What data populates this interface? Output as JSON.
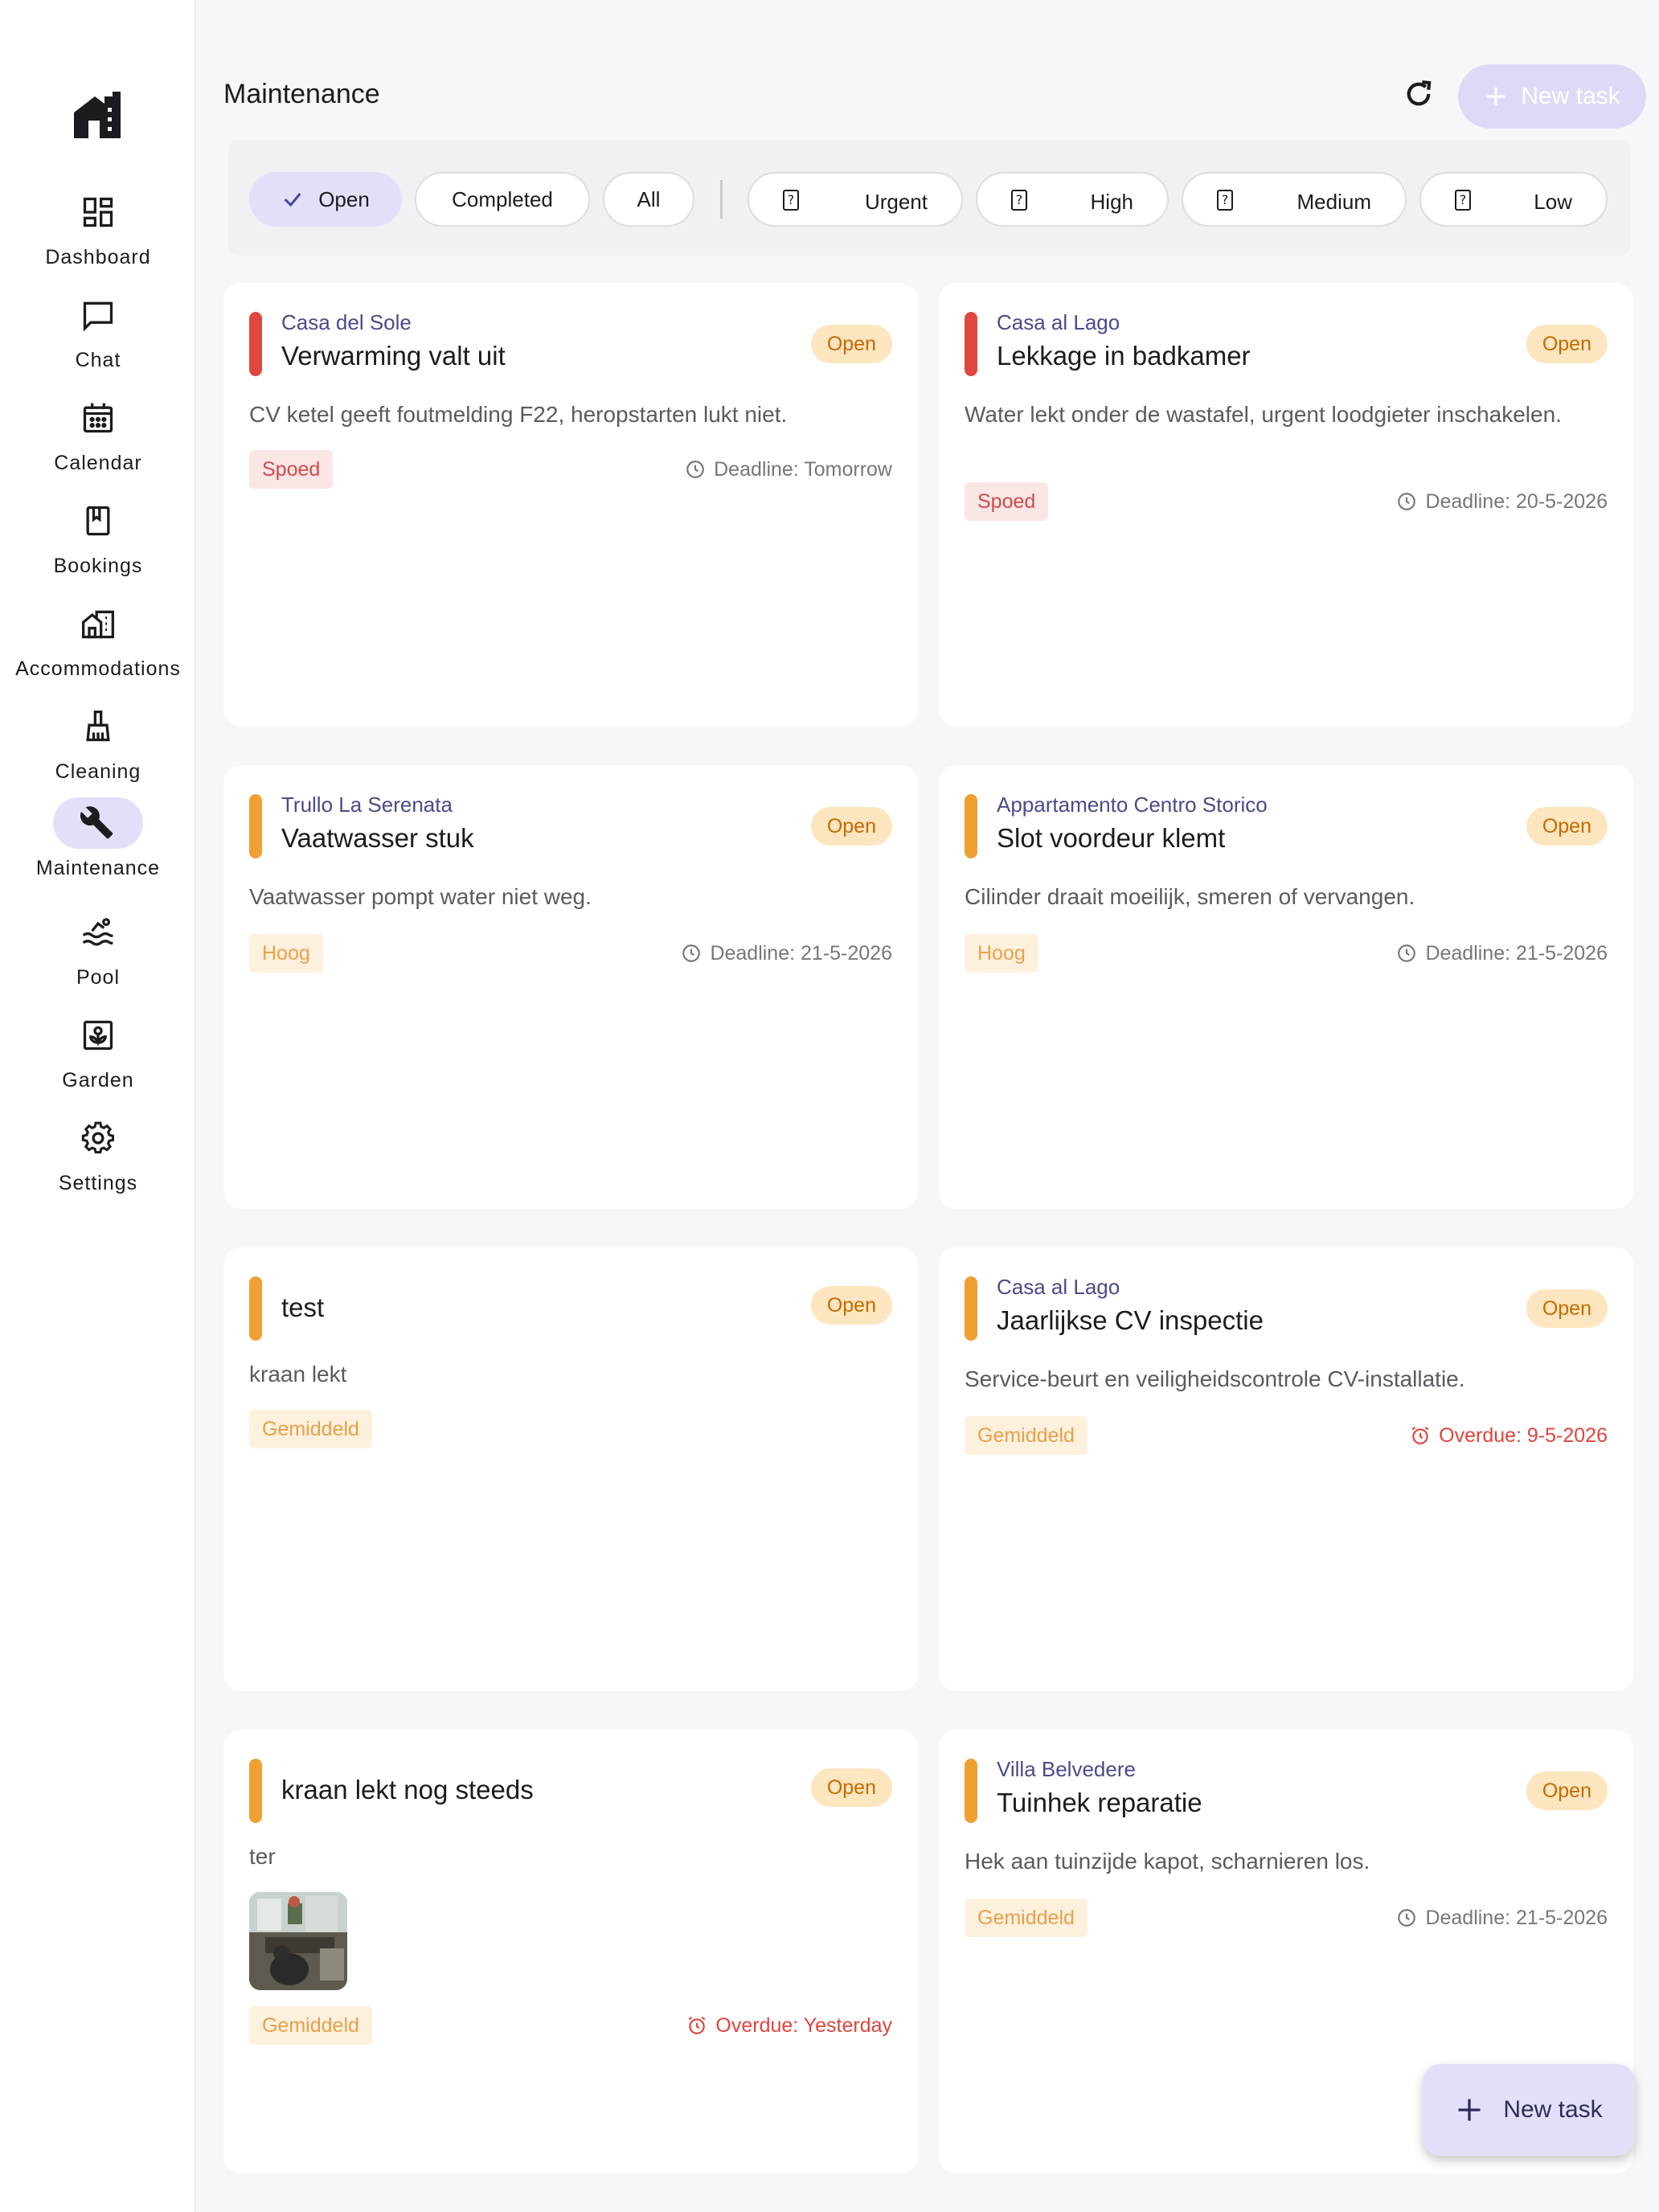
{
  "nav": {
    "items": [
      {
        "label": "Dashboard",
        "icon": "dashboard-icon"
      },
      {
        "label": "Chat",
        "icon": "chat-icon"
      },
      {
        "label": "Calendar",
        "icon": "calendar-icon"
      },
      {
        "label": "Bookings",
        "icon": "bookings-icon"
      },
      {
        "label": "Accommodations",
        "icon": "accommodations-icon"
      },
      {
        "label": "Cleaning",
        "icon": "cleaning-icon"
      },
      {
        "label": "Maintenance",
        "icon": "wrench-icon",
        "active": true
      },
      {
        "label": "Pool",
        "icon": "pool-icon"
      },
      {
        "label": "Garden",
        "icon": "garden-icon"
      },
      {
        "label": "Settings",
        "icon": "gear-icon"
      }
    ]
  },
  "header": {
    "title": "Maintenance",
    "new_task_label": "New task"
  },
  "filters": {
    "status": [
      {
        "label": "Open",
        "selected": true
      },
      {
        "label": "Completed"
      },
      {
        "label": "All"
      }
    ],
    "priority": [
      {
        "label": "Urgent"
      },
      {
        "label": "High"
      },
      {
        "label": "Medium"
      },
      {
        "label": "Low"
      }
    ],
    "unknown_glyph": "?"
  },
  "tasks": [
    {
      "location": "Casa del Sole",
      "title": "Verwarming valt uit",
      "status": "Open",
      "description": "CV ketel geeft foutmelding F22, heropstarten lukt niet.",
      "priority": "Spoed",
      "deadline": "Deadline: Tomorrow"
    },
    {
      "location": "Casa al Lago",
      "title": "Lekkage in badkamer",
      "status": "Open",
      "description": "Water lekt onder de wastafel, urgent loodgieter inschakelen.",
      "priority": "Spoed",
      "deadline": "Deadline: 20-5-2026"
    },
    {
      "location": "Trullo La Serenata",
      "title": "Vaatwasser stuk",
      "status": "Open",
      "description": "Vaatwasser pompt water niet weg.",
      "priority": "Hoog",
      "deadline": "Deadline: 21-5-2026"
    },
    {
      "location": "Appartamento Centro Storico",
      "title": "Slot voordeur klemt",
      "status": "Open",
      "description": "Cilinder draait moeilijk, smeren of vervangen.",
      "priority": "Hoog",
      "deadline": "Deadline: 21-5-2026"
    },
    {
      "location": "",
      "title": "test",
      "status": "Open",
      "description": "kraan lekt",
      "priority": "Gemiddeld",
      "deadline": ""
    },
    {
      "location": "Casa al Lago",
      "title": "Jaarlijkse CV inspectie",
      "status": "Open",
      "description": "Service-beurt en veiligheidscontrole CV-installatie.",
      "priority": "Gemiddeld",
      "deadline": "Overdue: 9-5-2026"
    },
    {
      "location": "",
      "title": "kraan lekt nog steeds",
      "status": "Open",
      "description": "ter",
      "priority": "Gemiddeld",
      "deadline": "Overdue: Yesterday"
    },
    {
      "location": "Villa Belvedere",
      "title": "Tuinhek reparatie",
      "status": "Open",
      "description": "Hek aan tuinzijde kapot, scharnieren los.",
      "priority": "Gemiddeld",
      "deadline": "Deadline: 21-5-2026"
    }
  ],
  "colors": {
    "urgent_stripe": "#e0473d",
    "high_stripe": "#f0a032",
    "accent": "#e2e0f9",
    "status_badge_bg": "#fde6bf",
    "overdue": "#e0443c"
  }
}
